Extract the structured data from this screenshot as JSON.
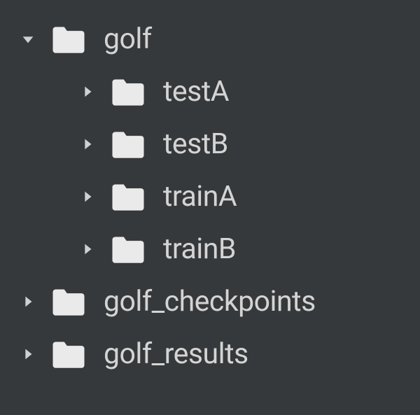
{
  "tree": [
    {
      "name": "golf",
      "expanded": true,
      "level": 0,
      "children": [
        {
          "name": "testA",
          "expanded": false,
          "level": 1
        },
        {
          "name": "testB",
          "expanded": false,
          "level": 1
        },
        {
          "name": "trainA",
          "expanded": false,
          "level": 1
        },
        {
          "name": "trainB",
          "expanded": false,
          "level": 1
        }
      ]
    },
    {
      "name": "golf_checkpoints",
      "expanded": false,
      "level": 0
    },
    {
      "name": "golf_results",
      "expanded": false,
      "level": 0
    }
  ]
}
